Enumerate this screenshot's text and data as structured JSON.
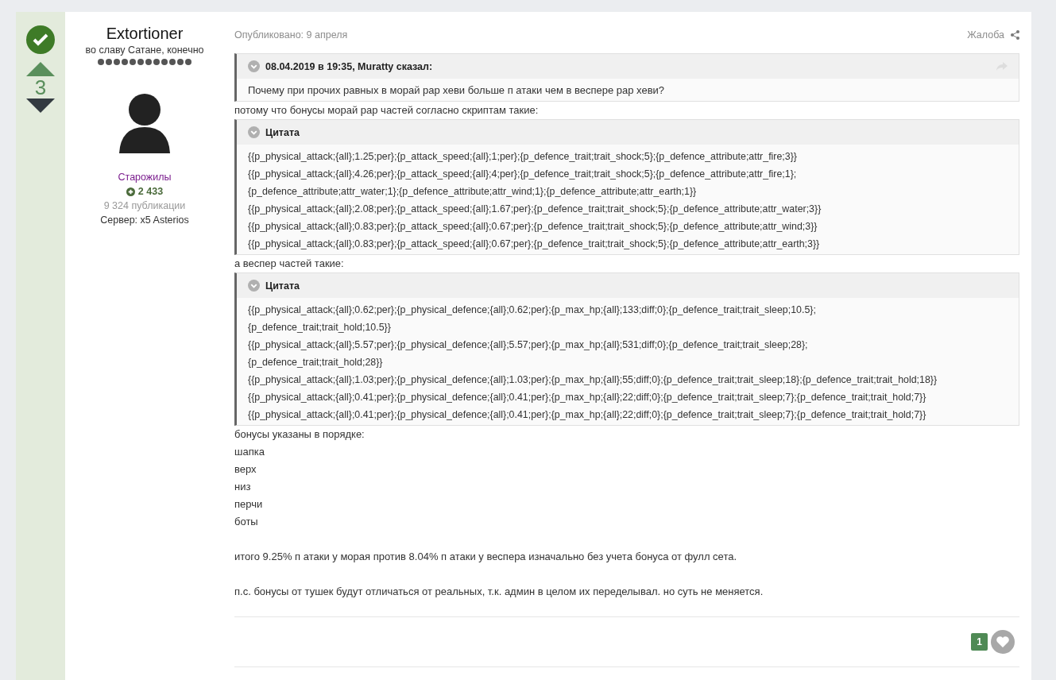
{
  "votes": {
    "solved": true,
    "count": "3"
  },
  "author": {
    "name": "Extortioner",
    "title": "во славу Сатане, конечно",
    "group": "Старожилы",
    "reputation": "2 433",
    "posts": "9 324 публикации",
    "server": "Сервер: x5 Asterios"
  },
  "post": {
    "published": "Опубликовано: 9 апреля",
    "report": "Жалоба",
    "blocks": [
      {
        "kind": "quote",
        "title": "08.04.2019 в 19:35, Muratty сказал:",
        "lines": [
          "Почему при прочих равных в морай рар хеви больше п атаки чем в веспере рар хеви?"
        ]
      },
      {
        "kind": "text",
        "lines": [
          "потому что бонусы морай рар частей согласно скриптам такие:"
        ]
      },
      {
        "kind": "quote",
        "title": "Цитата",
        "lines": [
          "{{p_physical_attack;{all};1.25;per};{p_attack_speed;{all};1;per};{p_defence_trait;trait_shock;5};{p_defence_attribute;attr_fire;3}}",
          "{{p_physical_attack;{all};4.26;per};{p_attack_speed;{all};4;per};{p_defence_trait;trait_shock;5};{p_defence_attribute;attr_fire;1};",
          "{p_defence_attribute;attr_water;1};{p_defence_attribute;attr_wind;1};{p_defence_attribute;attr_earth;1}}",
          "{{p_physical_attack;{all};2.08;per};{p_attack_speed;{all};1.67;per};{p_defence_trait;trait_shock;5};{p_defence_attribute;attr_water;3}}",
          "{{p_physical_attack;{all};0.83;per};{p_attack_speed;{all};0.67;per};{p_defence_trait;trait_shock;5};{p_defence_attribute;attr_wind;3}}",
          "{{p_physical_attack;{all};0.83;per};{p_attack_speed;{all};0.67;per};{p_defence_trait;trait_shock;5};{p_defence_attribute;attr_earth;3}}"
        ]
      },
      {
        "kind": "text",
        "lines": [
          "а веспер частей такие:"
        ]
      },
      {
        "kind": "quote",
        "title": "Цитата",
        "lines": [
          "{{p_physical_attack;{all};0.62;per};{p_physical_defence;{all};0.62;per};{p_max_hp;{all};133;diff;0};{p_defence_trait;trait_sleep;10.5};",
          "{p_defence_trait;trait_hold;10.5}}",
          "{{p_physical_attack;{all};5.57;per};{p_physical_defence;{all};5.57;per};{p_max_hp;{all};531;diff;0};{p_defence_trait;trait_sleep;28};",
          "{p_defence_trait;trait_hold;28}}",
          "{{p_physical_attack;{all};1.03;per};{p_physical_defence;{all};1.03;per};{p_max_hp;{all};55;diff;0};{p_defence_trait;trait_sleep;18};{p_defence_trait;trait_hold;18}}",
          "{{p_physical_attack;{all};0.41;per};{p_physical_defence;{all};0.41;per};{p_max_hp;{all};22;diff;0};{p_defence_trait;trait_sleep;7};{p_defence_trait;trait_hold;7}}",
          "{{p_physical_attack;{all};0.41;per};{p_physical_defence;{all};0.41;per};{p_max_hp;{all};22;diff;0};{p_defence_trait;trait_sleep;7};{p_defence_trait;trait_hold;7}}"
        ]
      },
      {
        "kind": "text",
        "lines": [
          "бонусы указаны в порядке:",
          "шапка",
          "верх",
          "низ",
          "перчи",
          "боты"
        ]
      },
      {
        "kind": "text",
        "lines": [
          "итого 9.25% п атаки у морая против 8.04% п атаки у веспера изначально без учета бонуса от фулл сета."
        ]
      },
      {
        "kind": "text",
        "lines": [
          "п.с. бонусы от тушек будут отличаться от реальных, т.к. админ в целом их переделывал. но суть не меняется."
        ]
      }
    ],
    "reactions": {
      "count": "1",
      "liked": false
    }
  }
}
